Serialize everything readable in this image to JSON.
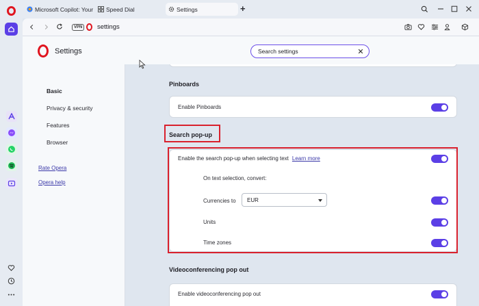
{
  "tabs": [
    {
      "label": "Microsoft Copilot: Your AI"
    },
    {
      "label": "Speed Dial"
    },
    {
      "label": "Settings"
    }
  ],
  "new_tab_label": "+",
  "address": {
    "vpn_label": "VPN",
    "url": "settings"
  },
  "header": {
    "title": "Settings",
    "search_value": "Search settings"
  },
  "settings_nav": {
    "items": [
      "Basic",
      "Privacy & security",
      "Features",
      "Browser"
    ],
    "links": [
      "Rate Opera",
      "Opera help"
    ]
  },
  "sections": {
    "pinboards": {
      "title": "Pinboards",
      "toggle_label": "Enable Pinboards",
      "enabled": true
    },
    "search_popup": {
      "title": "Search pop-up",
      "enable_label": "Enable the search pop-up when selecting text",
      "learn_more": "Learn more",
      "convert_label": "On text selection, convert:",
      "currencies_label": "Currencies to",
      "currency_value": "EUR",
      "units_label": "Units",
      "timezones_label": "Time zones"
    },
    "video": {
      "title": "Videoconferencing pop out",
      "toggle_label": "Enable videoconferencing pop out"
    }
  },
  "colors": {
    "accent": "#5b3fe6",
    "opera_red": "#e0151f",
    "highlight_box": "#d9202c"
  }
}
